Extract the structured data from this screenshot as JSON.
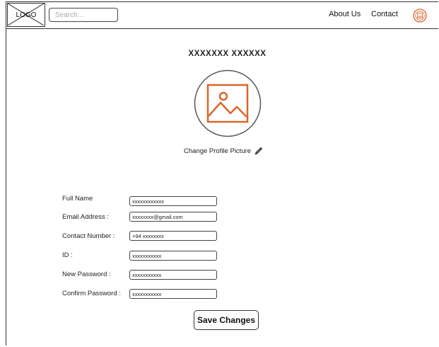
{
  "header": {
    "logo_text": "LOGO",
    "search_placeholder": "Search...",
    "nav": [
      {
        "label": "About Us"
      },
      {
        "label": "Contact"
      }
    ]
  },
  "profile": {
    "name": "XXXXXXX XXXXXX",
    "change_picture_label": "Change Profile Picture"
  },
  "form": {
    "fields": [
      {
        "label": "Full Name",
        "value": "xxxxxxxxxxxx"
      },
      {
        "label": "Email Address :",
        "value": "xxxxxxxx@gmail.com"
      },
      {
        "label": "Contact Number :",
        "value": "+94 xxxxxxxx"
      },
      {
        "label": "ID :",
        "value": "xxxxxxxxxxx"
      },
      {
        "label": "New Password :",
        "value": "xxxxxxxxxxx"
      },
      {
        "label": "Confirm Password :",
        "value": "xxxxxxxxxxx"
      }
    ],
    "save_label": "Save Changes"
  },
  "colors": {
    "accent": "#d9662b",
    "border": "#333333"
  }
}
